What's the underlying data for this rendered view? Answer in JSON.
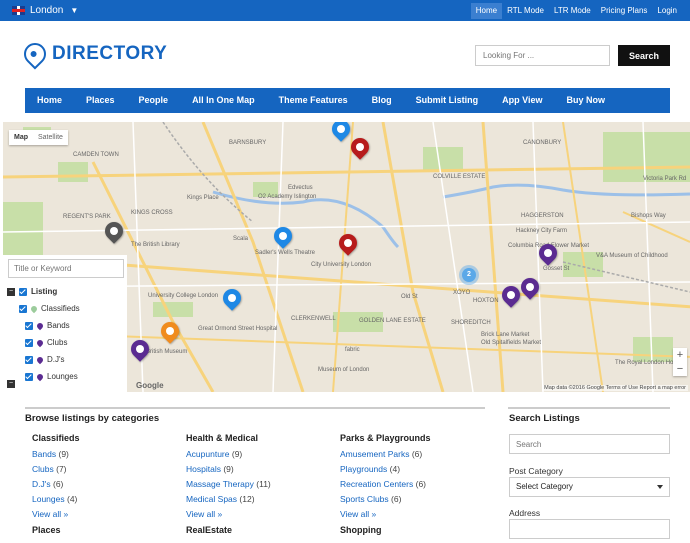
{
  "topbar": {
    "location": "London",
    "links": [
      {
        "label": "Home",
        "active": true
      },
      {
        "label": "RTL Mode",
        "active": false
      },
      {
        "label": "LTR Mode",
        "active": false
      },
      {
        "label": "Pricing Plans",
        "active": false
      },
      {
        "label": "Login",
        "active": false
      }
    ]
  },
  "header": {
    "logo_text": "DIRECTORY",
    "search_placeholder": "Looking For ...",
    "search_button": "Search"
  },
  "nav": [
    "Home",
    "Places",
    "People",
    "All In One Map",
    "Theme Features",
    "Blog",
    "Submit Listing",
    "App View",
    "Buy Now"
  ],
  "map": {
    "type_selected": "Map",
    "type_other": "Satellite",
    "attribution": "Map data ©2016 Google   Terms of Use   Report a map error",
    "google": "Google",
    "zoom_in": "+",
    "zoom_out": "−",
    "cluster_count": "2",
    "labels": [
      "CAMDEN TOWN",
      "BARNSBURY",
      "KINGS CROSS",
      "REGENT'S PARK",
      "CANONBURY",
      "HOXTON",
      "HAGGERSTON",
      "CLERKENWELL",
      "SHOREDITCH",
      "Edvectus",
      "O2 Academy Islington",
      "Sadler's Wells Theatre",
      "City University London",
      "The British Library",
      "Scala",
      "University College London",
      "Great Ormond Street Hospital",
      "British Museum",
      "Museum of London",
      "Brick Lane Market",
      "Old Spitalfields Market",
      "Columbia Road Flower Market",
      "Gosset St",
      "Hackney City Farm",
      "V&A Museum of Childhood",
      "The Royal London Hospital",
      "XOYO",
      "Old St",
      "Kings Place",
      "COLVILLE ESTATE",
      "GOLDEN LANE ESTATE",
      "fabric",
      "Victoria Park Rd",
      "Bishops Way"
    ],
    "colors": {
      "blue": "#1e88e5",
      "red": "#b71c1c",
      "purple": "#5b2b91",
      "orange": "#f08c1e",
      "grey": "#555555",
      "park": "#c8dfa8",
      "water": "#9cc0e8",
      "road": "#f7d37c"
    }
  },
  "filter": {
    "keyword_placeholder": "Title or Keyword",
    "root": "Listing",
    "group": "Classifieds",
    "items": [
      "Bands",
      "Clubs",
      "D.J's",
      "Lounges"
    ]
  },
  "browse": {
    "title": "Browse listings by categories",
    "columns": [
      {
        "heading": "Classifieds",
        "items": [
          {
            "name": "Bands",
            "count": "(9)"
          },
          {
            "name": "Clubs",
            "count": "(7)"
          },
          {
            "name": "D.J's",
            "count": "(6)"
          },
          {
            "name": "Lounges",
            "count": "(4)"
          }
        ]
      },
      {
        "heading": "Health & Medical",
        "items": [
          {
            "name": "Acupunture",
            "count": "(9)"
          },
          {
            "name": "Hospitals",
            "count": "(9)"
          },
          {
            "name": "Massage Therapy",
            "count": "(11)"
          },
          {
            "name": "Medical Spas",
            "count": "(12)"
          }
        ]
      },
      {
        "heading": "Parks & Playgrounds",
        "items": [
          {
            "name": "Amusement Parks",
            "count": "(6)"
          },
          {
            "name": "Playgrounds",
            "count": "(4)"
          },
          {
            "name": "Recreation Centers",
            "count": "(6)"
          },
          {
            "name": "Sports Clubs",
            "count": "(6)"
          }
        ]
      }
    ],
    "view_all": "View all »",
    "next_headings": [
      "Places",
      "RealEstate",
      "Shopping"
    ]
  },
  "search_listings": {
    "title": "Search Listings",
    "search_placeholder": "Search",
    "post_category_label": "Post Category",
    "post_category_value": "Select Category",
    "address_label": "Address"
  }
}
